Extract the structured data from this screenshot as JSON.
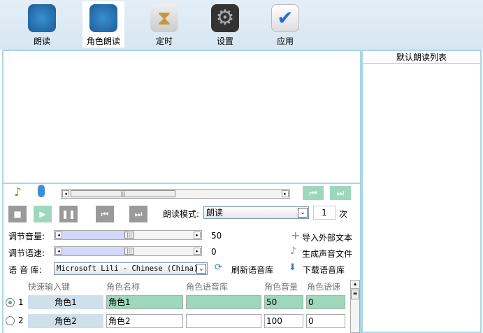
{
  "toolbar": [
    {
      "label": "朗读",
      "icon": "person-icon"
    },
    {
      "label": "角色朗读",
      "icon": "group-icon",
      "selected": true
    },
    {
      "label": "定时",
      "icon": "hourglass-icon"
    },
    {
      "label": "设置",
      "icon": "gear-icon"
    },
    {
      "label": "应用",
      "icon": "checkmark-icon"
    }
  ],
  "right_panel": {
    "title": "默认朗读列表"
  },
  "controls": {
    "mode_label": "朗读模式:",
    "mode_value": "朗读",
    "repeat_value": "1",
    "repeat_unit": "次",
    "volume_label": "调节音量:",
    "volume_value": "50",
    "speed_label": "调节语速:",
    "speed_value": "0",
    "voice_label": "语 音 库:",
    "voice_value": "Microsoft Lili - Chinese (China)",
    "refresh_label": "刷新语音库",
    "import_label": "导入外部文本",
    "generate_label": "生成声音文件",
    "download_label": "下载语音库"
  },
  "table": {
    "headers": [
      "快速输入键",
      "角色名称",
      "角色语音库",
      "角色音量",
      "角色语速"
    ],
    "rows": [
      {
        "index": "1",
        "key": "角色1",
        "name": "角色1",
        "library": "",
        "volume": "50",
        "speed": "0",
        "selected": true
      },
      {
        "index": "2",
        "key": "角色2",
        "name": "角色2",
        "library": "",
        "volume": "100",
        "speed": "0",
        "selected": false
      }
    ]
  },
  "colors": {
    "accent": "#9dd8bd",
    "border": "#a9d6e6"
  }
}
